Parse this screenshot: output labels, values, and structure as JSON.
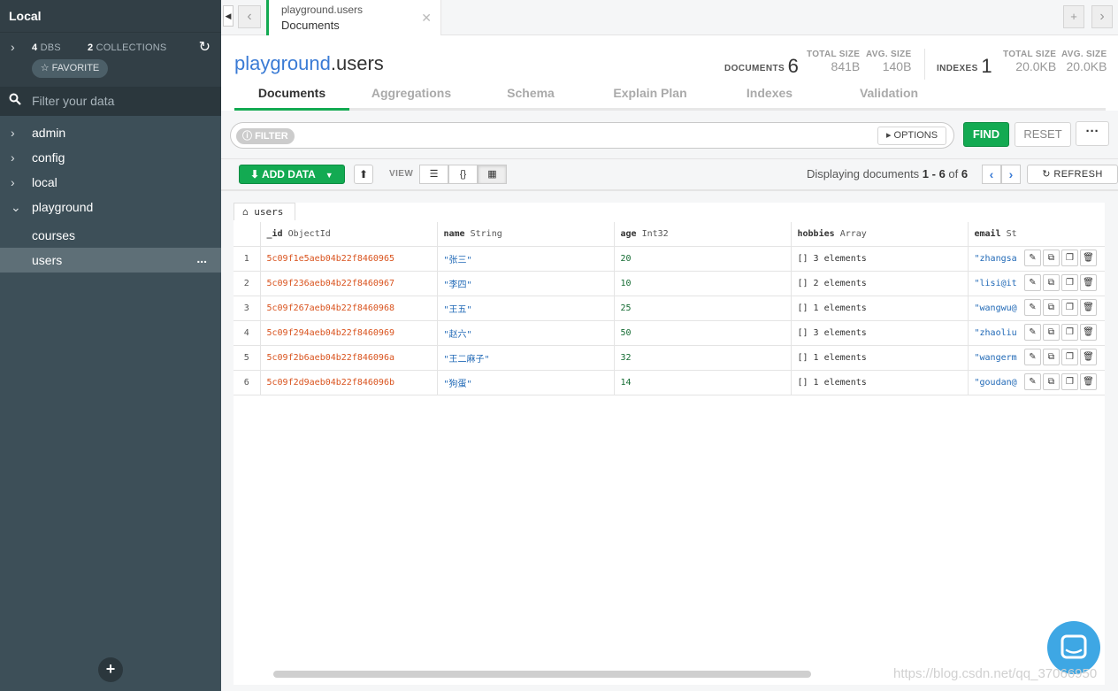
{
  "sidebar": {
    "title": "Local",
    "dbs_count": "4",
    "dbs_label": "DBS",
    "collections_count": "2",
    "collections_label": "COLLECTIONS",
    "favorite_label": "☆ FAVORITE",
    "filter_placeholder": "Filter your data",
    "databases": [
      {
        "name": "admin"
      },
      {
        "name": "config"
      },
      {
        "name": "local"
      },
      {
        "name": "playground"
      }
    ],
    "collections": [
      {
        "name": "courses"
      },
      {
        "name": "users",
        "more": "..."
      }
    ],
    "add_label": "+"
  },
  "tab": {
    "line1": "playground.users",
    "line2": "Documents"
  },
  "header": {
    "db": "playground",
    "coll": ".users",
    "documents_label": "DOCUMENTS",
    "documents_count": "6",
    "doc_total_size_label": "TOTAL SIZE",
    "doc_total_size": "841B",
    "doc_avg_size_label": "AVG. SIZE",
    "doc_avg_size": "140B",
    "indexes_label": "INDEXES",
    "indexes_count": "1",
    "idx_total_size_label": "TOTAL SIZE",
    "idx_total_size": "20.0KB",
    "idx_avg_size_label": "AVG. SIZE",
    "idx_avg_size": "20.0KB"
  },
  "subtabs": [
    "Documents",
    "Aggregations",
    "Schema",
    "Explain Plan",
    "Indexes",
    "Validation"
  ],
  "query": {
    "filter_label": "FILTER",
    "options_label": "OPTIONS",
    "find_label": "FIND",
    "reset_label": "RESET",
    "more_label": "···"
  },
  "toolbar": {
    "add_data_label": "ADD DATA",
    "view_label": "VIEW",
    "displaying_prefix": "Displaying documents ",
    "range": "1 - 6",
    "of_label": " of ",
    "total": "6",
    "refresh_label": "REFRESH"
  },
  "grid": {
    "collection_tab": "users",
    "columns": [
      {
        "name": "_id",
        "type": "ObjectId"
      },
      {
        "name": "name",
        "type": "String"
      },
      {
        "name": "age",
        "type": "Int32"
      },
      {
        "name": "hobbies",
        "type": "Array"
      },
      {
        "name": "email",
        "type": "St"
      }
    ],
    "rows": [
      {
        "n": "1",
        "id": "5c09f1e5aeb04b22f8460965",
        "name": "\"张三\"",
        "age": "20",
        "hobbies": "[] 3 elements",
        "email": "\"zhangsa"
      },
      {
        "n": "2",
        "id": "5c09f236aeb04b22f8460967",
        "name": "\"李四\"",
        "age": "10",
        "hobbies": "[] 2 elements",
        "email": "\"lisi@it"
      },
      {
        "n": "3",
        "id": "5c09f267aeb04b22f8460968",
        "name": "\"王五\"",
        "age": "25",
        "hobbies": "[] 1 elements",
        "email": "\"wangwu@"
      },
      {
        "n": "4",
        "id": "5c09f294aeb04b22f8460969",
        "name": "\"赵六\"",
        "age": "50",
        "hobbies": "[] 3 elements",
        "email": "\"zhaoliu"
      },
      {
        "n": "5",
        "id": "5c09f2b6aeb04b22f846096a",
        "name": "\"王二麻子\"",
        "age": "32",
        "hobbies": "[] 1 elements",
        "email": "\"wangerm"
      },
      {
        "n": "6",
        "id": "5c09f2d9aeb04b22f846096b",
        "name": "\"狗蛋\"",
        "age": "14",
        "hobbies": "[] 1 elements",
        "email": "\"goudan@"
      }
    ]
  },
  "watermark": "https://blog.csdn.net/qq_37066950",
  "colors": {
    "accent_green": "#13aa52",
    "sidebar_bg": "#3d4f58",
    "objectid": "#d9531e",
    "string": "#1f68b6",
    "int": "#146b32"
  },
  "icons": [
    "chevron-right-icon",
    "refresh-icon",
    "star-icon",
    "search-icon",
    "download-icon",
    "upload-icon",
    "list-view-icon",
    "json-view-icon",
    "table-view-icon",
    "home-icon",
    "edit-icon",
    "copy-icon",
    "clone-icon",
    "trash-icon",
    "chat-icon"
  ]
}
